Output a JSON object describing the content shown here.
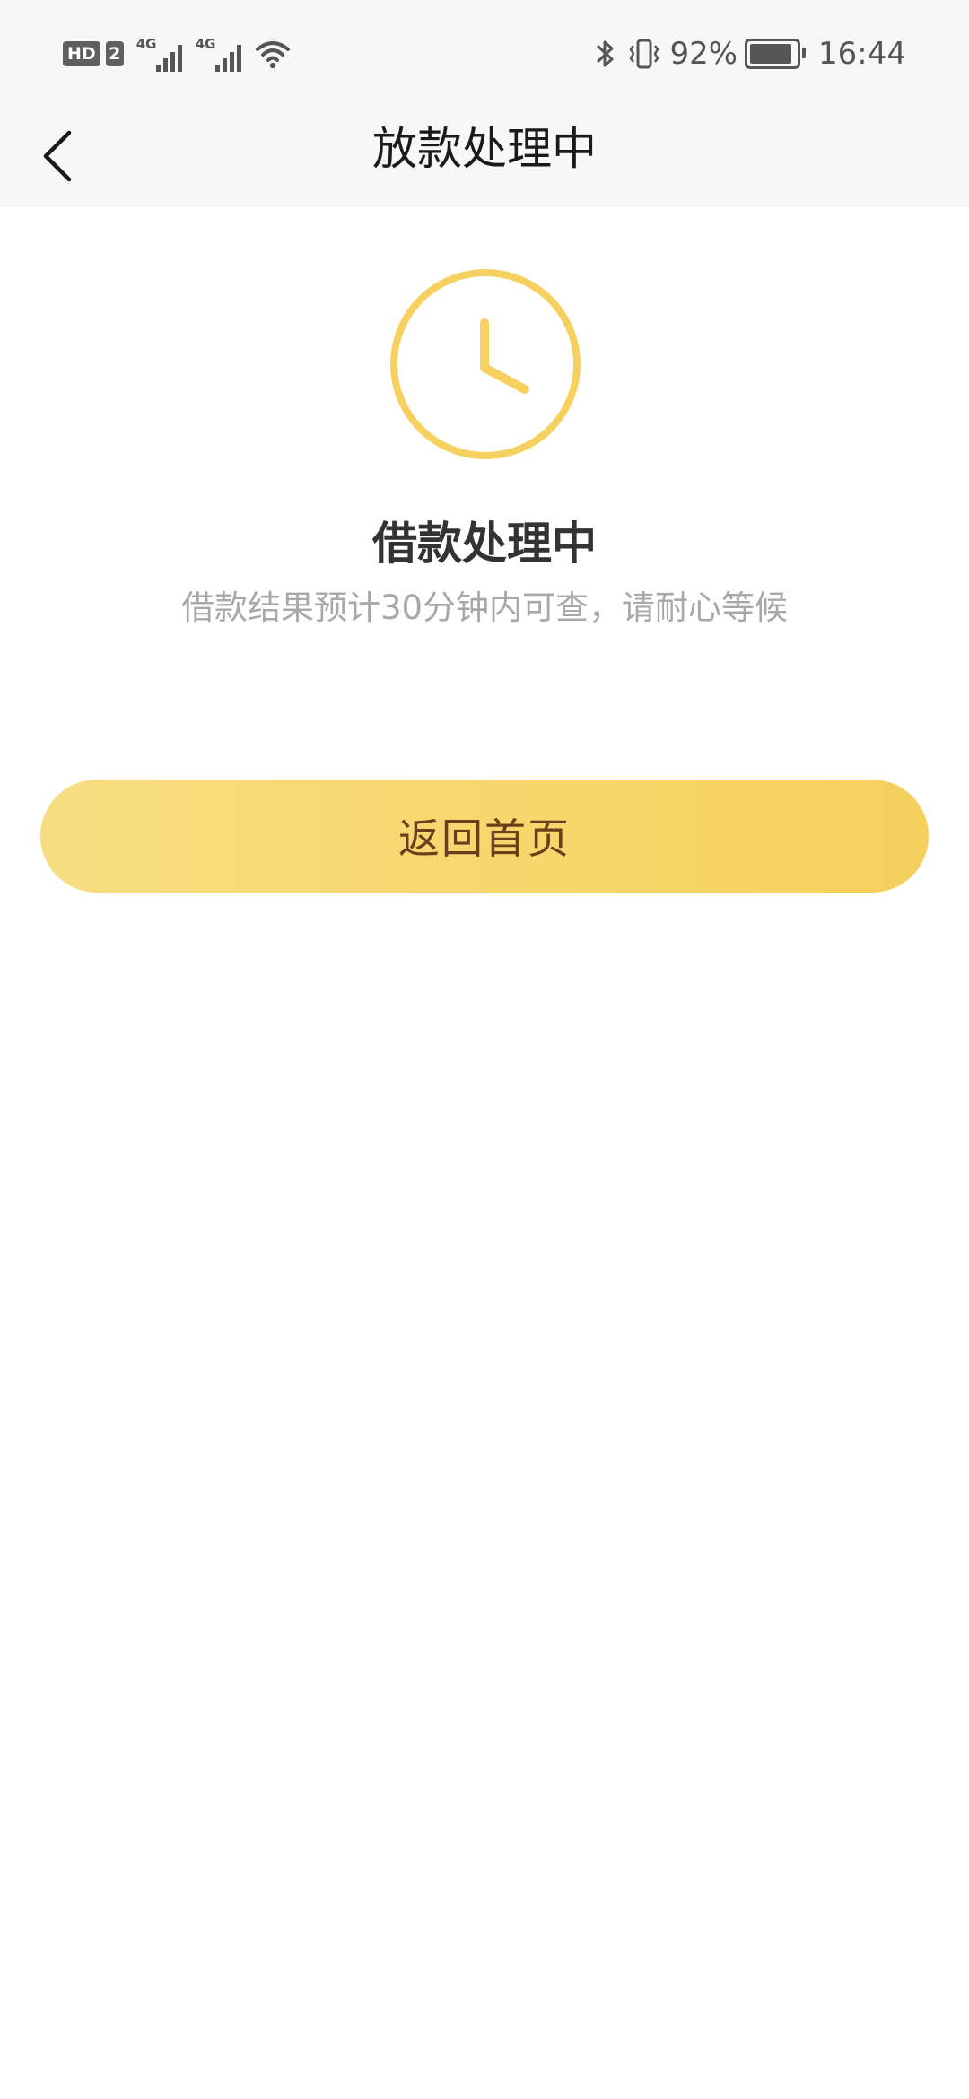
{
  "status_bar": {
    "hd_label": "HD",
    "sim_label": "2",
    "network_1": "4G",
    "network_2": "4G",
    "battery_percent_text": "92%",
    "battery_level": 0.92,
    "time": "16:44",
    "icons": [
      "bluetooth-icon",
      "vibrate-icon",
      "wifi-icon",
      "battery-icon",
      "signal-icon"
    ]
  },
  "nav": {
    "title": "放款处理中",
    "back_icon": "chevron-left-icon"
  },
  "status": {
    "icon": "clock-icon",
    "title": "借款处理中",
    "description": "借款结果预计30分钟内可查，请耐心等候"
  },
  "actions": {
    "home_label": "返回首页"
  },
  "colors": {
    "accent": "#f6d15f",
    "button_text": "#6b3f1e",
    "header_bg": "#f7f7f7",
    "muted_text": "#a8a8a8"
  }
}
